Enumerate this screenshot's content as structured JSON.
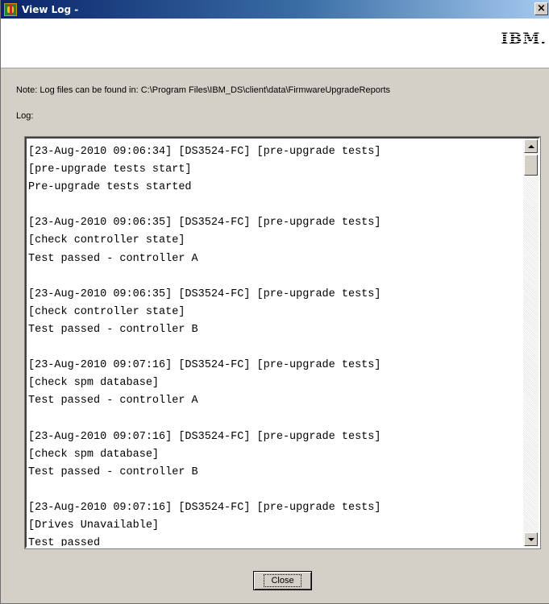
{
  "window": {
    "title": "View Log -",
    "close_glyph": "×",
    "icon": "app-icon"
  },
  "banner": {
    "logo_text": "IBM."
  },
  "note": "Note: Log files can be found in: C:\\Program Files\\IBM_DS\\client\\data\\FirmwareUpgradeReports",
  "log_label": "Log:",
  "log_lines": [
    "[23-Aug-2010 09:06:34] [DS3524-FC] [pre-upgrade tests]",
    "[pre-upgrade tests start]",
    "Pre-upgrade tests started",
    "",
    "[23-Aug-2010 09:06:35] [DS3524-FC] [pre-upgrade tests]",
    "[check controller state]",
    "Test passed - controller A",
    "",
    "[23-Aug-2010 09:06:35] [DS3524-FC] [pre-upgrade tests]",
    "[check controller state]",
    "Test passed - controller B",
    "",
    "[23-Aug-2010 09:07:16] [DS3524-FC] [pre-upgrade tests]",
    "[check spm database]",
    "Test passed - controller A",
    "",
    "[23-Aug-2010 09:07:16] [DS3524-FC] [pre-upgrade tests]",
    "[check spm database]",
    "Test passed - controller B",
    "",
    "[23-Aug-2010 09:07:16] [DS3524-FC] [pre-upgrade tests]",
    "[Drives Unavailable]",
    "Test passed"
  ],
  "buttons": {
    "close_label": "Close"
  },
  "icons": {
    "scroll_up": "scroll-up-arrow-icon",
    "scroll_down": "scroll-down-arrow-icon"
  },
  "colors": {
    "titlebar_start": "#0a246a",
    "titlebar_end": "#a6caf0",
    "dialog_bg": "#d4d0c8"
  }
}
